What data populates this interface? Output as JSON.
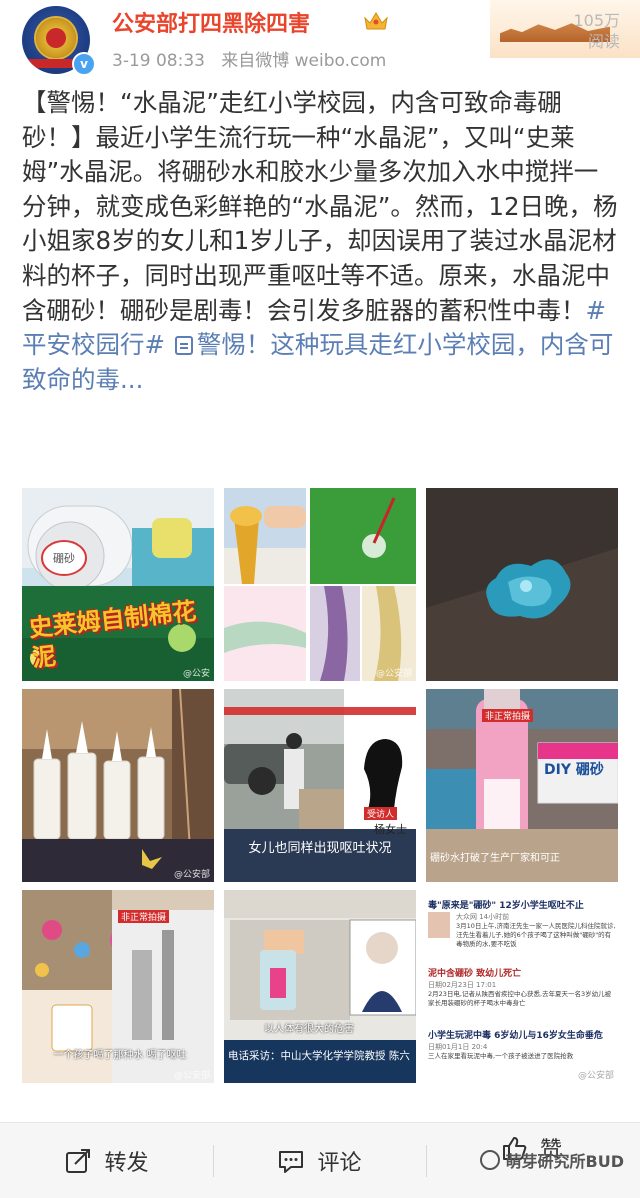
{
  "account": {
    "name": "公安部打四黑除四害",
    "timestamp": "3-19 08:33",
    "source": "来自微博 weibo.com",
    "reads_count": "105万",
    "reads_label": "阅读"
  },
  "post": {
    "text_segments": [
      {
        "type": "text",
        "value": "【警惕！“水晶泥”走红小学校园，内含可致命毒硼砂！】最近小学生流行玩一种“水晶泥”，又叫“史莱姆”水晶泥。将硼砂水和胶水少量多次加入水中搅拌一分钟，就变成色彩鲜艳的“水晶泥”。然而，12日晚，杨小姐家8岁的女儿和1岁儿子，却因误用了装过水晶泥材料的杯子，同时出现严重呕吐等不适。原来，水晶泥中含硼砂！硼砂是剧毒！会引发多脏器的蓄积性中毒！"
      },
      {
        "type": "link",
        "value": "#平安校园行#"
      },
      {
        "type": "text",
        "value": " "
      },
      {
        "type": "link-icon",
        "value": "link-icon"
      },
      {
        "type": "link",
        "value": "警惕！这种玩具走红小学校园，内含可致命的毒..."
      }
    ]
  },
  "images": {
    "img1": {
      "label_bottle": "硼砂",
      "label_title": "史莱姆自制棉花泥",
      "watermark": "@公安"
    },
    "img2": {
      "watermark": "@公安部"
    },
    "img3": {},
    "img4": {
      "watermark": "@公安部"
    },
    "img5": {
      "caption": "女儿也同样出现呕吐状况",
      "label_person": "杨女士",
      "tag": "受访人"
    },
    "img6": {
      "tag": "非正常拍摄",
      "label_box": "DIY 硼砂",
      "caption": "硼砂水打破了生产厂家和可正"
    },
    "img7": {
      "tag": "非正常拍摄",
      "caption": "一个孩子喝了那种水 喝了呕吐",
      "watermark": "@公安部"
    },
    "img8": {
      "caption": "以人体有很大的危害",
      "banner": "电话采访：中山大学化学学院教授 陈六"
    },
    "img9": {
      "headline1": "毒\"原来是\"硼砂\" 12岁小学生呕吐不止",
      "src1": "大众网 14小时前",
      "body1": "3月10日上午,济南汪先生一家一人民医院儿科住院就诊,汪先生看着儿子,她的6个孩子喝了这种叫做\"硼砂\"的有毒物质的水,要不吃饭",
      "headline2": "泥中含硼砂 致幼儿死亡",
      "src2": "日期02月23日 17:01",
      "body2": "2月23日电,记者从陕西省疾控中心获悉,去年夏天一名3岁幼儿被家长用装硼砂的杯子喝水中毒身亡",
      "headline3": "小学生玩泥中毒 6岁幼儿与16岁女生命垂危",
      "src3": "日期01月1日 20:4",
      "body3": "三人在家里看玩泥中毒,一个孩子被送进了医院抢救",
      "watermark": "@公安部"
    }
  },
  "actions": {
    "repost": "转发",
    "comment": "评论",
    "like": "赞"
  },
  "watermark": "萌芽研究所BUD",
  "colors": {
    "name": "#e8452c",
    "link": "#5b7fb5",
    "text": "#333333",
    "meta": "#9a9a9a"
  }
}
